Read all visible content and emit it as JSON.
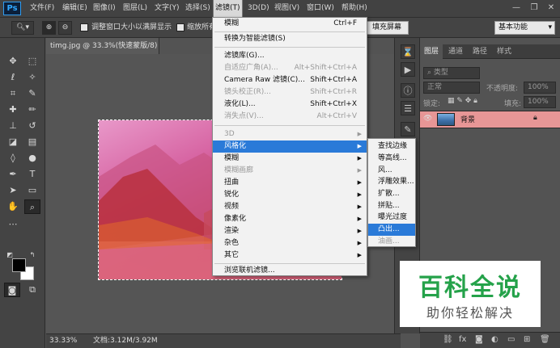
{
  "app": {
    "logo": "Ps"
  },
  "menubar": {
    "items": [
      "文件(F)",
      "编辑(E)",
      "图像(I)",
      "图层(L)",
      "文字(Y)",
      "选择(S)",
      "滤镜(T)",
      "3D(D)",
      "视图(V)",
      "窗口(W)",
      "帮助(H)"
    ],
    "active": "滤镜(T)"
  },
  "window_controls": {
    "minimize": "—",
    "restore": "❐",
    "close": "✕"
  },
  "options_bar": {
    "resize_window_label": "调整窗口大小以满屏显示",
    "zoom_all_label": "缩放所有窗",
    "fill_screen_label": "填充屏幕",
    "workspace": "基本功能"
  },
  "document": {
    "tab_title": "timg.jpg @ 33.3%(快速蒙版/8) *",
    "zoom": "33.33%",
    "doc_size": "文档:3.12M/3.92M"
  },
  "filter_menu": {
    "items": [
      {
        "label": "模糊",
        "shortcut": "Ctrl+F",
        "disabled": false
      },
      {
        "label": "转换为智能滤镜(S)",
        "shortcut": "",
        "disabled": false
      },
      {
        "label": "滤镜库(G)...",
        "shortcut": "",
        "disabled": false
      },
      {
        "label": "自适应广角(A)...",
        "shortcut": "Alt+Shift+Ctrl+A",
        "disabled": true
      },
      {
        "label": "Camera Raw 滤镜(C)...",
        "shortcut": "Shift+Ctrl+A",
        "disabled": false
      },
      {
        "label": "镜头校正(R)...",
        "shortcut": "Shift+Ctrl+R",
        "disabled": true
      },
      {
        "label": "液化(L)...",
        "shortcut": "Shift+Ctrl+X",
        "disabled": false
      },
      {
        "label": "消失点(V)...",
        "shortcut": "Alt+Ctrl+V",
        "disabled": true
      },
      {
        "label": "3D",
        "disabled": true,
        "submenu": true
      },
      {
        "label": "风格化",
        "disabled": false,
        "submenu": true,
        "highlighted": true
      },
      {
        "label": "模糊",
        "disabled": false,
        "submenu": true
      },
      {
        "label": "模糊画廊",
        "disabled": true,
        "submenu": true
      },
      {
        "label": "扭曲",
        "disabled": false,
        "submenu": true
      },
      {
        "label": "锐化",
        "disabled": false,
        "submenu": true
      },
      {
        "label": "视频",
        "disabled": false,
        "submenu": true
      },
      {
        "label": "像素化",
        "disabled": false,
        "submenu": true
      },
      {
        "label": "渲染",
        "disabled": false,
        "submenu": true
      },
      {
        "label": "杂色",
        "disabled": false,
        "submenu": true
      },
      {
        "label": "其它",
        "disabled": false,
        "submenu": true
      },
      {
        "label": "浏览联机滤镜...",
        "disabled": false
      }
    ]
  },
  "stylize_submenu": {
    "items": [
      {
        "label": "查找边缘",
        "disabled": false
      },
      {
        "label": "等高线...",
        "disabled": false
      },
      {
        "label": "风...",
        "disabled": false
      },
      {
        "label": "浮雕效果...",
        "disabled": false
      },
      {
        "label": "扩散...",
        "disabled": false
      },
      {
        "label": "拼贴...",
        "disabled": false
      },
      {
        "label": "曝光过度",
        "disabled": false
      },
      {
        "label": "凸出...",
        "disabled": false,
        "highlighted": true
      },
      {
        "label": "油画...",
        "disabled": true
      }
    ]
  },
  "layers_panel": {
    "tabs": [
      "图层",
      "通道",
      "路径",
      "样式"
    ],
    "kind_filter": "类型",
    "blend_mode": "正常",
    "opacity_label": "不透明度:",
    "opacity_value": "100%",
    "lock_label": "锁定:",
    "fill_label": "填充:",
    "fill_value": "100%",
    "layer_name": "背景"
  },
  "watermark": {
    "title": "百科全说",
    "subtitle": "助你轻松解决"
  }
}
